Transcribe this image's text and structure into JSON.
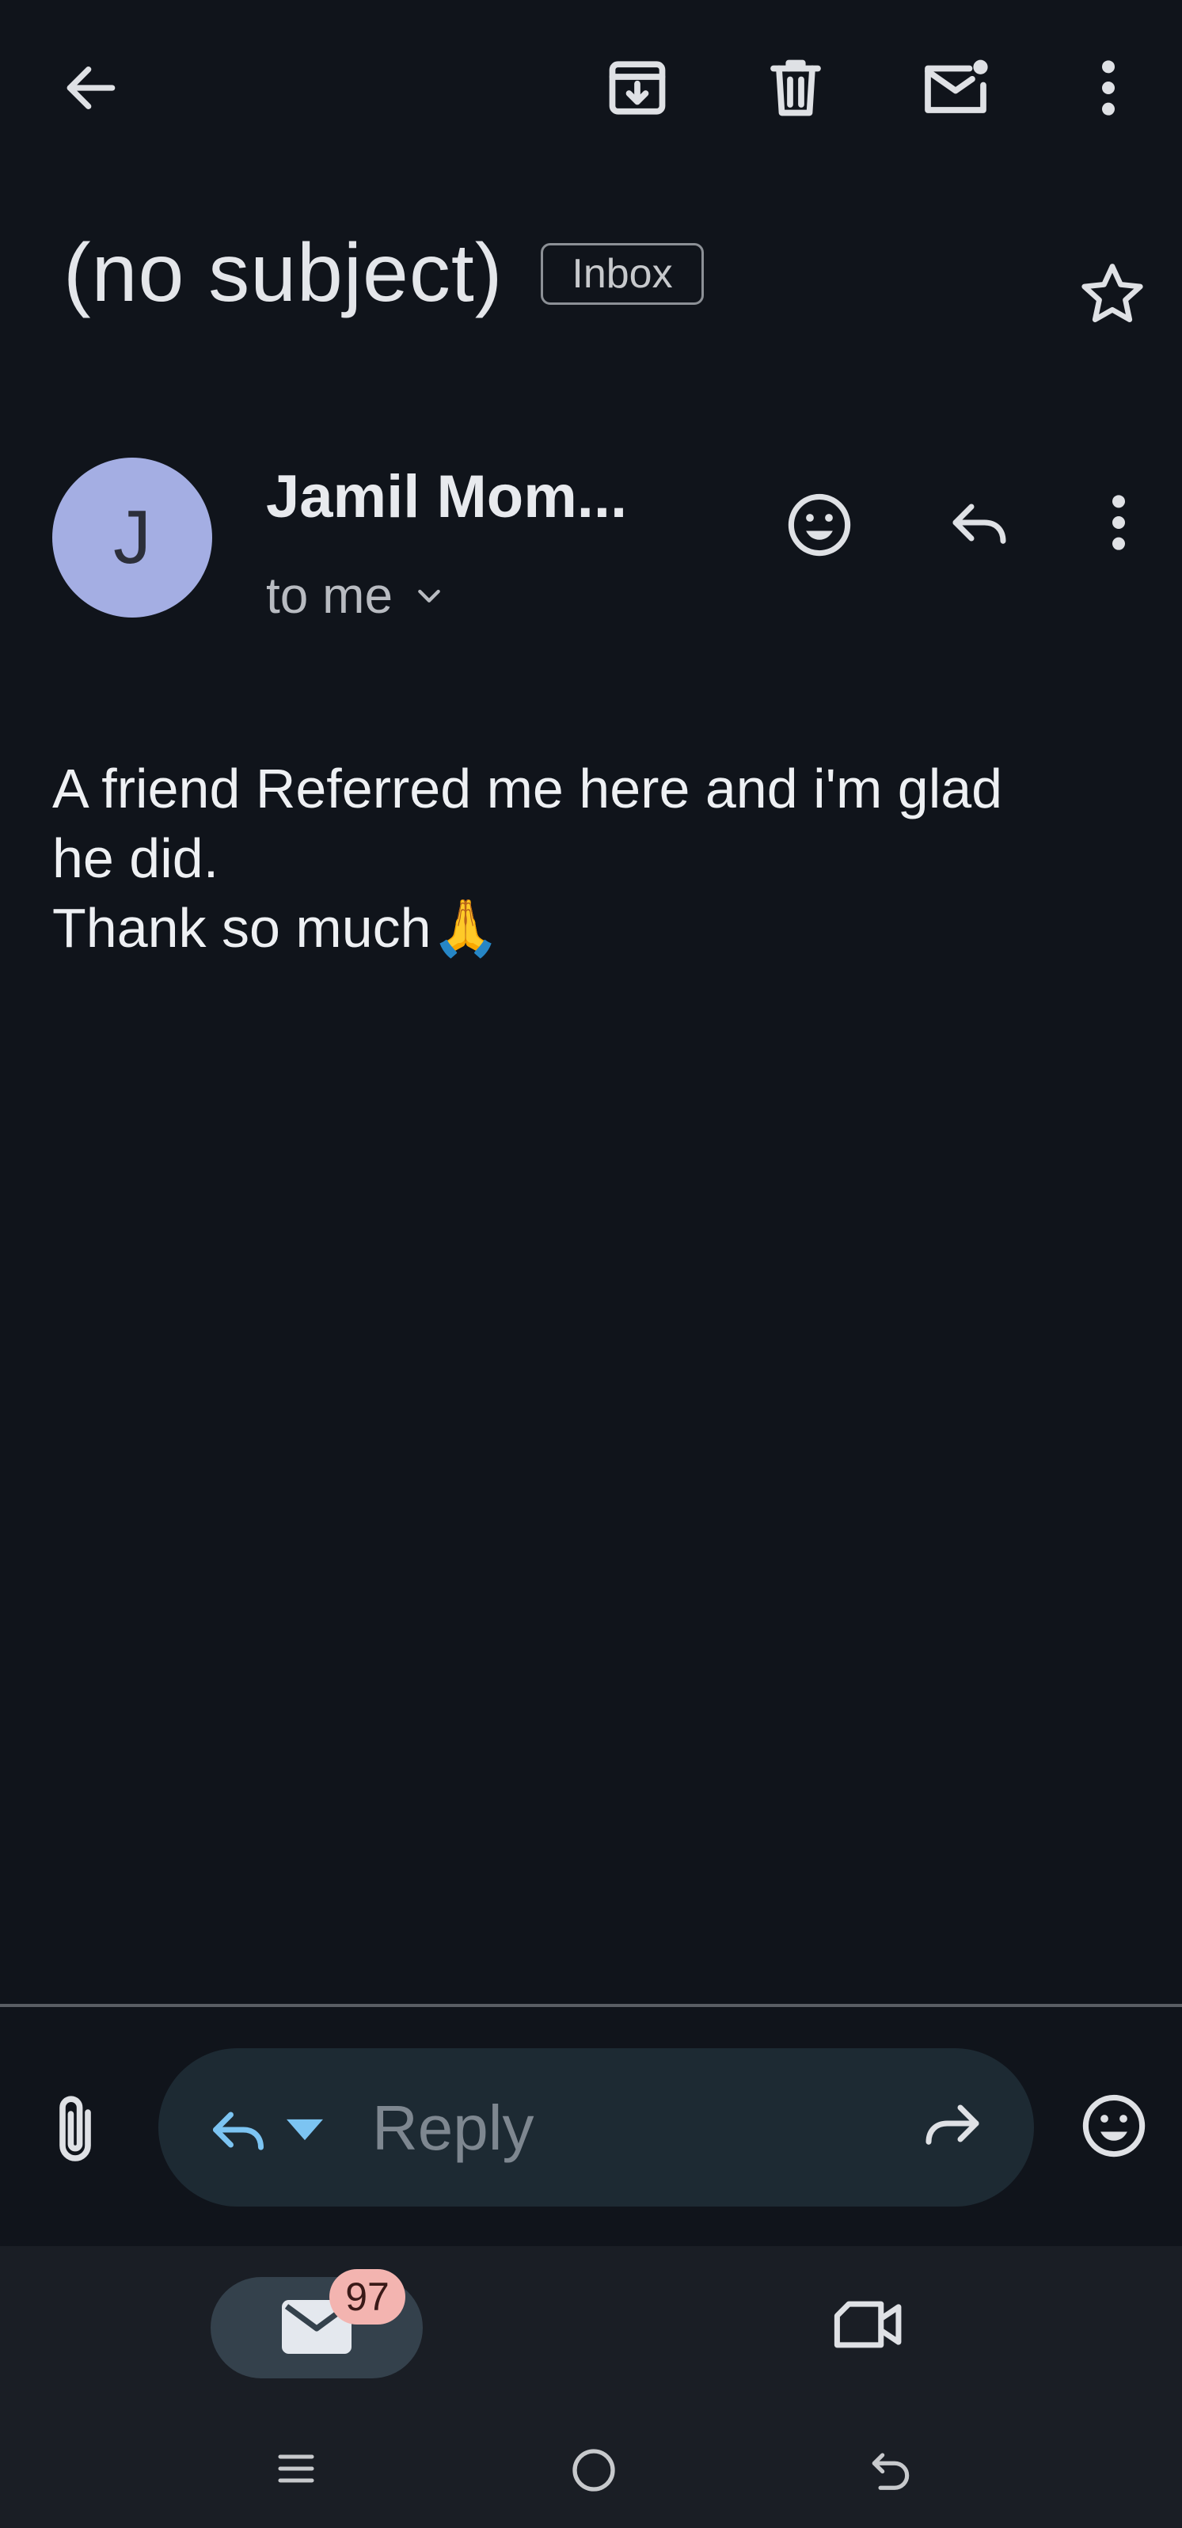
{
  "toolbar": {
    "back_icon": "arrow-left-icon",
    "archive_icon": "archive-icon",
    "delete_icon": "trash-icon",
    "mark_unread_icon": "mail-unread-icon",
    "more_icon": "more-vert-icon"
  },
  "subject": {
    "title": "(no subject)",
    "label_chip": "Inbox",
    "star_icon": "star-outline-icon"
  },
  "sender": {
    "avatar_letter": "J",
    "name": "Jamil Mom...",
    "recipient": "to me",
    "avatar_color": "#a4aee3"
  },
  "message": {
    "line1": "A friend Referred me here and i'm glad",
    "line2": "he did.",
    "line3": "Thank so much",
    "emoji": "🙏"
  },
  "reply_bar": {
    "placeholder": "Reply"
  },
  "bottom_nav": {
    "mail_badge": "97"
  },
  "colors": {
    "background": "#10141b",
    "accent_reply": "#7cc4f2",
    "badge": "#f3b4b0"
  }
}
